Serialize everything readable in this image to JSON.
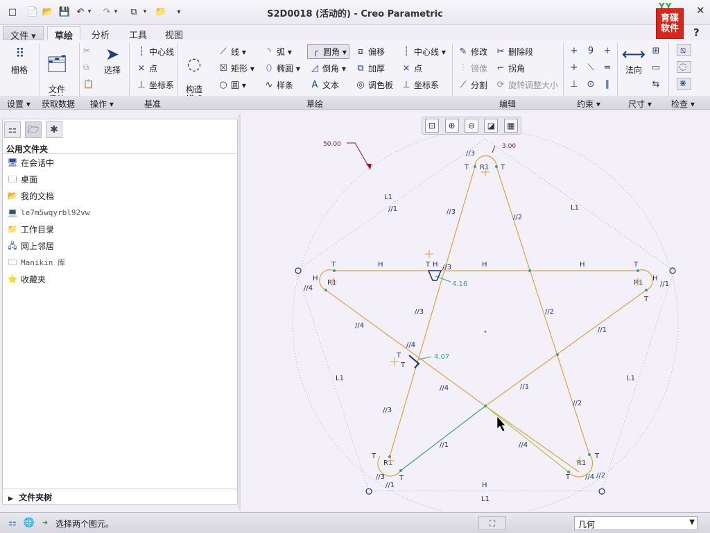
{
  "window": {
    "title": "S2D0018 (活动的) - Creo Parametric"
  },
  "brand": {
    "top": "YY",
    "line1": "育碟",
    "line2": "软件"
  },
  "window_controls": {
    "minimize": "–",
    "close": "✕",
    "help": "?"
  },
  "quick_access": [
    "□",
    "📄",
    "📂",
    "💾",
    "↶",
    "▾",
    "↷",
    "▾",
    "⧉",
    "▾",
    "📁",
    "▾"
  ],
  "tabs": [
    {
      "label": "文件 ▾"
    },
    {
      "label": "草绘"
    },
    {
      "label": "分析"
    },
    {
      "label": "工具"
    },
    {
      "label": "视图"
    }
  ],
  "ribbon": {
    "grid_label": "栅格",
    "file_system_label": "文件\n系统",
    "select_label": "选择",
    "construct_label": "构造\n模式",
    "datum": {
      "centerline": "中心线",
      "point": "点",
      "csys": "坐标系"
    },
    "sketch": {
      "line": "线",
      "rect": "矩形",
      "circle": "圆",
      "arc": "弧",
      "ellipse": "椭圆",
      "spline": "样条",
      "fillet": "圆角",
      "chamfer": "倒角",
      "text": "文本",
      "offset": "偏移",
      "thicken": "加厚",
      "palette": "调色板",
      "centerline": "中心线",
      "point": "点",
      "csys": "坐标系"
    },
    "edit": {
      "modify": "修改",
      "delete_segment": "删除段",
      "mirror": "镜像",
      "corner": "拐角",
      "divide": "分割",
      "rotate_resize": "旋转调整大小"
    },
    "dimension_normal": "法向"
  },
  "groups": {
    "setup": "设置 ▾",
    "get_data": "获取数据",
    "operations": "操作 ▾",
    "datum": "基准",
    "sketching": "草绘",
    "editing": "编辑",
    "constrain": "约束 ▾",
    "dimension": "尺寸 ▾",
    "inspect": "检查 ▾"
  },
  "left_panel": {
    "header": "公用文件夹",
    "folders": [
      {
        "icon": "session-icon",
        "label": "在会话中"
      },
      {
        "icon": "desktop-icon",
        "label": "桌面"
      },
      {
        "icon": "documents-icon",
        "label": "我的文档"
      },
      {
        "icon": "computer-icon",
        "label": "le7m5wqyrbl92vw"
      },
      {
        "icon": "workdir-icon",
        "label": "工作目录"
      },
      {
        "icon": "network-icon",
        "label": "网上邻居"
      },
      {
        "icon": "library-icon",
        "label": "Manikin 库"
      },
      {
        "icon": "favorites-icon",
        "label": "收藏夹"
      }
    ],
    "tree_label": "文件夹树"
  },
  "sketch": {
    "dim_radius_top": "3.00",
    "dim_circle": "50.00",
    "dim_left_upper": "4.16",
    "dim_left_lower": "4.07",
    "constraint_H": "H",
    "constraint_T": "T",
    "constraint_R1": "R1",
    "constraint_L1": "L1",
    "parallel_1": "//1",
    "parallel_2": "//2",
    "parallel_3": "//3",
    "parallel_4": "//4"
  },
  "status": {
    "message": "选择两个图元。",
    "filter": "几何"
  },
  "colors": {
    "sketch_line": "#d9a441",
    "selected_line": "#3a9f8f",
    "dimension": "#8b1a1a",
    "constraint": "#1d2f7a"
  }
}
